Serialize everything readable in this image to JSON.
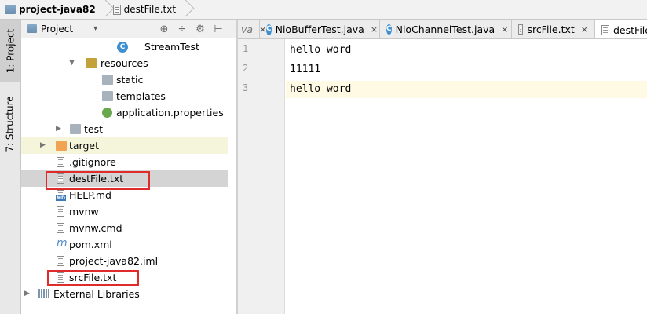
{
  "breadcrumb": {
    "project": "project-java82",
    "file": "destFile.txt"
  },
  "toolstrip": {
    "project_tab": "1: Project",
    "structure_tab": "7: Structure"
  },
  "panel": {
    "title": "Project",
    "dropdown": "▾",
    "tools": [
      "⊕",
      "÷",
      "⚙",
      "⊢"
    ]
  },
  "tree": [
    {
      "label": "StreamTest",
      "icon": "java-class-icon",
      "arrow": ""
    },
    {
      "label": "resources",
      "icon": "resources-folder-icon",
      "arrow": "▼"
    },
    {
      "label": "static",
      "icon": "folder-icon",
      "arrow": ""
    },
    {
      "label": "templates",
      "icon": "folder-icon",
      "arrow": ""
    },
    {
      "label": "application.properties",
      "icon": "spring-properties-icon",
      "arrow": ""
    },
    {
      "label": "test",
      "icon": "folder-icon",
      "arrow": "▶"
    },
    {
      "label": "target",
      "icon": "excluded-folder-icon",
      "arrow": "▶"
    },
    {
      "label": ".gitignore",
      "icon": "text-file-icon",
      "arrow": ""
    },
    {
      "label": "destFile.txt",
      "icon": "text-file-icon",
      "arrow": ""
    },
    {
      "label": "HELP.md",
      "icon": "markdown-file-icon",
      "arrow": ""
    },
    {
      "label": "mvnw",
      "icon": "text-file-icon",
      "arrow": ""
    },
    {
      "label": "mvnw.cmd",
      "icon": "text-file-icon",
      "arrow": ""
    },
    {
      "label": "pom.xml",
      "icon": "maven-icon",
      "arrow": ""
    },
    {
      "label": "project-java82.iml",
      "icon": "module-file-icon",
      "arrow": ""
    },
    {
      "label": "srcFile.txt",
      "icon": "text-file-icon",
      "arrow": ""
    },
    {
      "label": "External Libraries",
      "icon": "library-icon",
      "arrow": "▶"
    }
  ],
  "tabs": [
    {
      "label": "va",
      "close": "×"
    },
    {
      "label": "NioBufferTest.java",
      "close": "×"
    },
    {
      "label": "NioChannelTest.java",
      "close": "×"
    },
    {
      "label": "srcFile.txt",
      "close": "×"
    },
    {
      "label": "destFile.txt",
      "close": "×"
    }
  ],
  "editor": {
    "line_numbers": [
      "1",
      "2",
      "3"
    ],
    "lines": [
      "hello word",
      "11111",
      "hello word"
    ]
  },
  "colors": {
    "highlight_box": "#e02b2b",
    "current_line": "#fffae3",
    "selection": "#d4d4d4"
  }
}
